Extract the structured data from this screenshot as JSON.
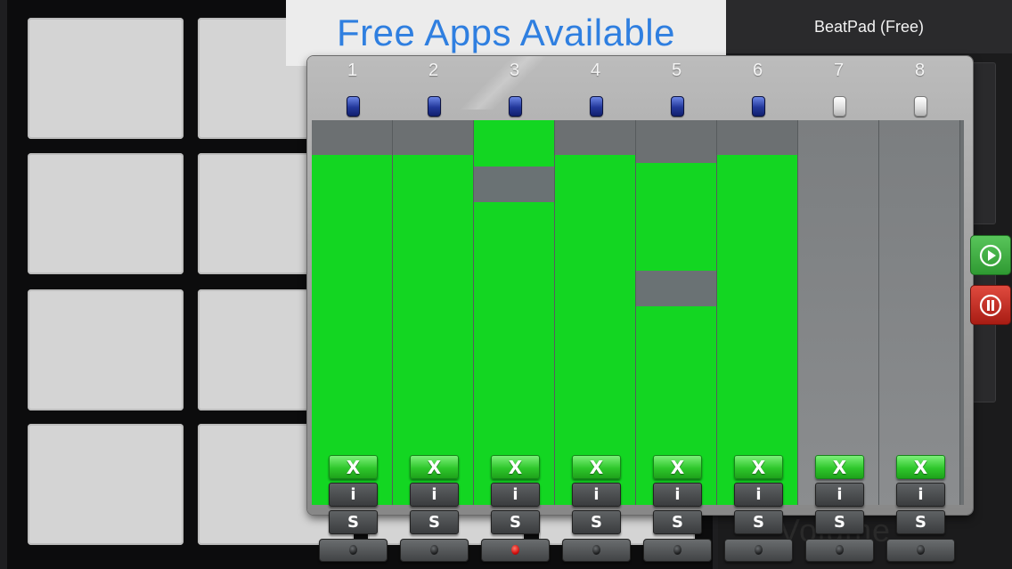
{
  "banner": {
    "text": "Free Apps Available",
    "color": "#2f7fe0"
  },
  "app": {
    "title": "BeatPad (Free)"
  },
  "background": {
    "volume_label": "Volume",
    "pad_color": "#d4d4d4"
  },
  "mixer": {
    "accent_fill": "#13d622",
    "channels": [
      {
        "number": "1",
        "led": "on",
        "fill_level": 0.91,
        "gap": null,
        "button_x": "X",
        "button_i": "i",
        "button_s": "S",
        "knob_active": false
      },
      {
        "number": "2",
        "led": "on",
        "fill_level": 0.91,
        "gap": null,
        "button_x": "X",
        "button_i": "i",
        "button_s": "S",
        "knob_active": false
      },
      {
        "number": "3",
        "led": "on",
        "fill_level": 1.0,
        "gap": "upper",
        "button_x": "X",
        "button_i": "i",
        "button_s": "S",
        "knob_active": true
      },
      {
        "number": "4",
        "led": "on",
        "fill_level": 0.91,
        "gap": null,
        "button_x": "X",
        "button_i": "i",
        "button_s": "S",
        "knob_active": false
      },
      {
        "number": "5",
        "led": "on",
        "fill_level": 0.89,
        "gap": "middle",
        "button_x": "X",
        "button_i": "i",
        "button_s": "S",
        "knob_active": false
      },
      {
        "number": "6",
        "led": "on",
        "fill_level": 0.91,
        "gap": null,
        "button_x": "X",
        "button_i": "i",
        "button_s": "S",
        "knob_active": false
      },
      {
        "number": "7",
        "led": "off",
        "fill_level": 0.0,
        "gap": null,
        "button_x": "X",
        "button_i": "i",
        "button_s": "S",
        "knob_active": false
      },
      {
        "number": "8",
        "led": "off",
        "fill_level": 0.0,
        "gap": null,
        "button_x": "X",
        "button_i": "i",
        "button_s": "S",
        "knob_active": false
      }
    ]
  },
  "transport": {
    "play_icon": "play-icon",
    "pause_icon": "pause-icon",
    "play_color": "#2f9a32",
    "pause_color": "#a81c14"
  }
}
